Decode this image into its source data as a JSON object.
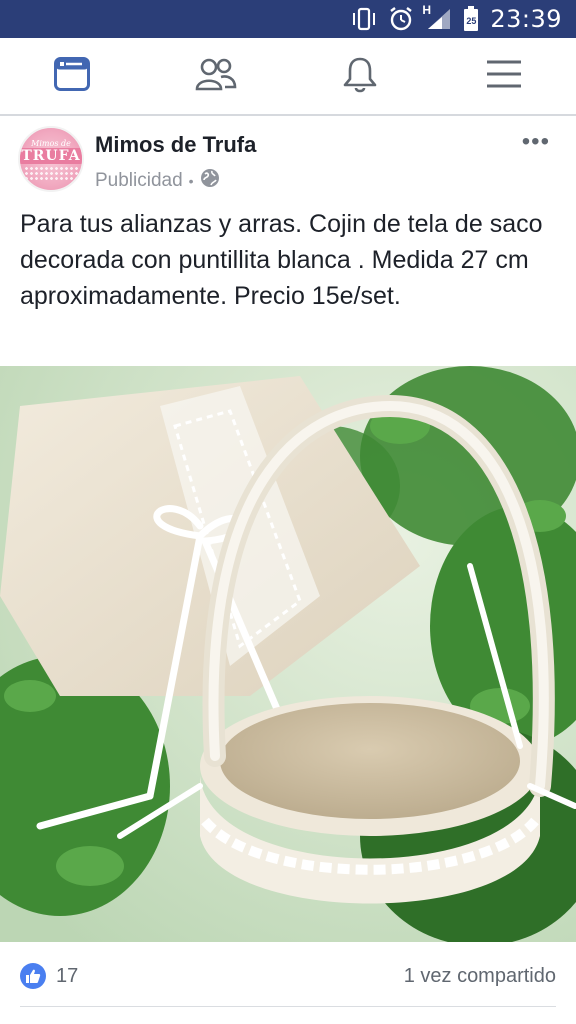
{
  "status_bar": {
    "time": "23:39",
    "network_label": "H",
    "battery_level": "25",
    "icons": [
      "vibrate-icon",
      "alarm-icon",
      "signal-icon",
      "battery-icon"
    ]
  },
  "nav": {
    "items": [
      {
        "name": "news-feed",
        "icon": "news-feed-icon",
        "active": true
      },
      {
        "name": "friends",
        "icon": "friends-icon",
        "active": false
      },
      {
        "name": "notifications",
        "icon": "bell-icon",
        "active": false
      },
      {
        "name": "menu",
        "icon": "hamburger-icon",
        "active": false
      }
    ],
    "active_color": "#4267b2",
    "inactive_color": "#606770"
  },
  "post": {
    "page_name": "Mimos de Trufa",
    "avatar": {
      "small_text": "Mimos de",
      "big_text": "TRUFA"
    },
    "sponsored_label": "Publicidad",
    "separator": "•",
    "privacy_icon": "globe-icon",
    "more_label": "•••",
    "text": "Para tus alianzas y arras. Cojin de tela de saco decorada con puntillita blanca . Medida 27 cm aproximadamente. Precio 15e/set.",
    "image_alt": "Cojín de tela de saco con puntilla blanca y cesta de arras"
  },
  "footer": {
    "like_count": "17",
    "share_text": "1 vez compartido",
    "like_color": "#4a7ff0"
  }
}
